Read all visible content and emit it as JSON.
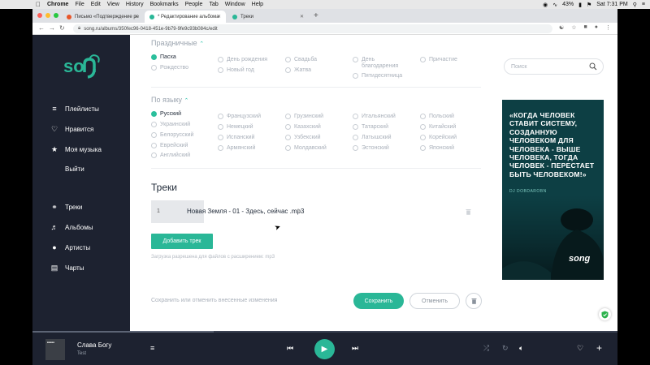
{
  "macbar": {
    "app": "Chrome",
    "menus": [
      "File",
      "Edit",
      "View",
      "History",
      "Bookmarks",
      "People",
      "Tab",
      "Window",
      "Help"
    ],
    "battery": "43%",
    "clock": "Sat 7:31 PM"
  },
  "browser": {
    "tabs": [
      {
        "label": "Письмо «Подтверждение ре",
        "active": false
      },
      {
        "label": "* Редактирование альбома",
        "active": true
      },
      {
        "label": "Треки",
        "active": false
      }
    ],
    "url": "song.ru/albums/350fec96-0418-451e-9b79-9fe9c93b084c/edit"
  },
  "sidebar": {
    "main_items": [
      {
        "label": "Плейлисты",
        "icon": "playlist-icon"
      },
      {
        "label": "Нравится",
        "icon": "heart-icon"
      },
      {
        "label": "Моя музыка",
        "icon": "star-icon"
      },
      {
        "label": "Выйти",
        "icon": ""
      }
    ],
    "lib_items": [
      {
        "label": "Треки",
        "icon": "headphones-icon"
      },
      {
        "label": "Альбомы",
        "icon": "album-icon"
      },
      {
        "label": "Артисты",
        "icon": "person-icon"
      },
      {
        "label": "Чарты",
        "icon": "chart-icon"
      }
    ]
  },
  "holidays": {
    "heading": "Праздничные",
    "options": [
      {
        "label": "Пасха",
        "selected": true
      },
      {
        "label": "Рождество",
        "selected": false
      },
      {
        "label": "День рождения",
        "selected": false
      },
      {
        "label": "Новый год",
        "selected": false
      },
      {
        "label": "Свадьба",
        "selected": false
      },
      {
        "label": "Жатва",
        "selected": false
      },
      {
        "label": "День благодарения",
        "selected": false
      },
      {
        "label": "Пятидесятница",
        "selected": false
      },
      {
        "label": "Причастие",
        "selected": false
      }
    ]
  },
  "languages": {
    "heading": "По языку",
    "options": [
      {
        "label": "Русский",
        "selected": true
      },
      {
        "label": "Украинский",
        "selected": false
      },
      {
        "label": "Белорусский",
        "selected": false
      },
      {
        "label": "Еврейский",
        "selected": false
      },
      {
        "label": "Английский",
        "selected": false
      },
      {
        "label": "Французский",
        "selected": false
      },
      {
        "label": "Немецкий",
        "selected": false
      },
      {
        "label": "Испанский",
        "selected": false
      },
      {
        "label": "Армянский",
        "selected": false
      },
      {
        "label": "Грузинский",
        "selected": false
      },
      {
        "label": "Казахский",
        "selected": false
      },
      {
        "label": "Узбекский",
        "selected": false
      },
      {
        "label": "Молдавский",
        "selected": false
      },
      {
        "label": "Итальянский",
        "selected": false
      },
      {
        "label": "Татарский",
        "selected": false
      },
      {
        "label": "Латышский",
        "selected": false
      },
      {
        "label": "Эстонский",
        "selected": false
      },
      {
        "label": "Польский",
        "selected": false
      },
      {
        "label": "Китайский",
        "selected": false
      },
      {
        "label": "Корейский",
        "selected": false
      },
      {
        "label": "Японский",
        "selected": false
      }
    ]
  },
  "search": {
    "placeholder": "Поиск"
  },
  "poster": {
    "quote": "«КОГДА ЧЕЛОВЕК СТАВИТ СИСТЕМУ, СОЗДАННУЮ ЧЕЛОВЕКОМ ДЛЯ ЧЕЛОВЕКА - ВЫШЕ ЧЕЛОВЕКА, ТОГДА ЧЕЛОВЕК - ПЕРЕСТАЕТ БЫТЬ ЧЕЛОВЕКОМ!»",
    "author": "DJ DOBDAROBN",
    "logo": "song"
  },
  "tracks": {
    "heading": "Треки",
    "items": [
      {
        "number": "1",
        "title": "Новая Земля - 01 - Здесь, сейчас .mp3"
      }
    ],
    "add_label": "Добавить трек",
    "hint": "Загрузка разрешена для файлов с расширением: mp3"
  },
  "actions": {
    "hint": "Сохранить или отменить внесенные изменения",
    "save_label": "Сохранить",
    "cancel_label": "Отменить"
  },
  "player": {
    "title": "Слава Богу",
    "artist": "Test",
    "progress": 0.31
  },
  "colors": {
    "accent": "#2ab797",
    "sidebar": "#1d2230"
  }
}
